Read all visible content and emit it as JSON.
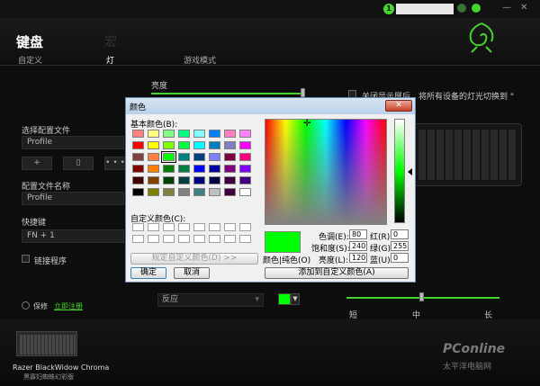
{
  "header": {
    "badge": "1",
    "title": "键盘",
    "title_secondary": "宏",
    "minimize": "—",
    "close": "✕"
  },
  "tabs": [
    "自定义",
    "灯",
    "游戏模式"
  ],
  "lighting": {
    "brightness_label": "亮度",
    "sync_text": "关闭显示屏后，将所有设备的灯光切换到 \"",
    "effect_value": "反应",
    "effect_color": "#00ff00",
    "speed_labels": [
      "短",
      "中",
      "长"
    ]
  },
  "left": {
    "select_profile_label": "选择配置文件",
    "profile_value": "Profile",
    "btn_add": "+",
    "btn_mid": "▯",
    "btn_more": "• • •",
    "profile_name_label": "配置文件名称",
    "profile_name_value": "Profile",
    "hotkey_label": "快捷键",
    "hotkey_value": "FN + 1",
    "link_program": "链接程序",
    "protect": "保修",
    "register": "立即注册"
  },
  "dialog": {
    "title": "颜色",
    "close": "✕",
    "basic_colors_label": "基本颜色(B):",
    "custom_colors_label": "自定义颜色(C):",
    "define_custom_button": "规定自定义颜色(D) >>",
    "ok_button": "确定",
    "cancel_button": "取消",
    "color_solid_label": "颜色|纯色(O)",
    "add_custom_button": "添加到自定义颜色(A)",
    "hue_label": "色调(E):",
    "hue": "80",
    "sat_label": "饱和度(S):",
    "sat": "240",
    "lum_label": "亮度(L):",
    "lum": "120",
    "red_label": "红(R):",
    "red": "0",
    "green_label": "绿(G):",
    "green": "255",
    "blue_label": "蓝(U):",
    "blue": "0",
    "current_color": "#00ff00",
    "basic_colors": [
      [
        "#ff8080",
        "#ffff80",
        "#80ff80",
        "#00ff80",
        "#80ffff",
        "#0080ff",
        "#ff80c0",
        "#ff80ff"
      ],
      [
        "#ff0000",
        "#ffff00",
        "#80ff00",
        "#00ff40",
        "#00ffff",
        "#0080c0",
        "#8080c0",
        "#ff00ff"
      ],
      [
        "#804040",
        "#ff8040",
        "#00ff00",
        "#008080",
        "#004080",
        "#8080ff",
        "#800040",
        "#ff0080"
      ],
      [
        "#800000",
        "#ff8000",
        "#008000",
        "#008040",
        "#0000ff",
        "#0000a0",
        "#800080",
        "#8000ff"
      ],
      [
        "#400000",
        "#804000",
        "#004000",
        "#004040",
        "#000080",
        "#000040",
        "#400040",
        "#400080"
      ],
      [
        "#000000",
        "#808000",
        "#808040",
        "#808080",
        "#408080",
        "#c0c0c0",
        "#400040",
        "#ffffff"
      ]
    ]
  },
  "device": {
    "name": "Razer BlackWidow Chroma",
    "subtitle": "黑寡妇蜘蛛幻彩版"
  },
  "watermark": {
    "brand": "PConline",
    "sub": "太平洋电脑网"
  }
}
